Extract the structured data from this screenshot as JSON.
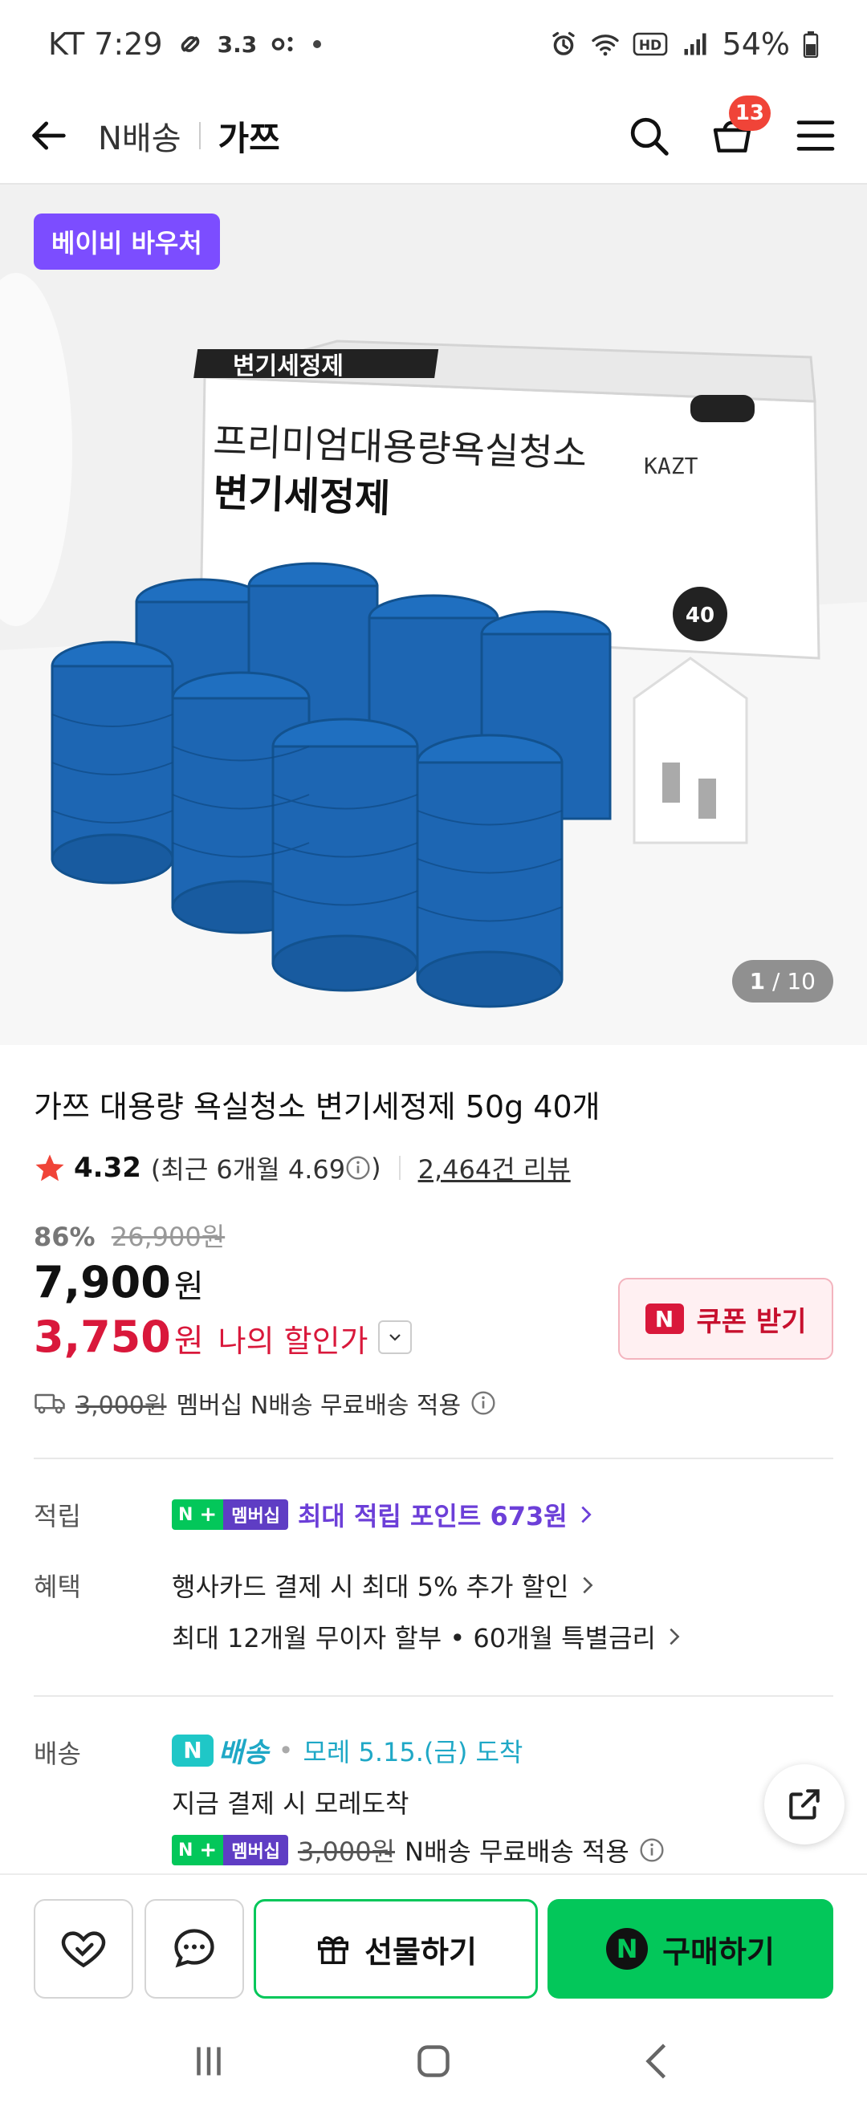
{
  "status_bar": {
    "carrier_time": "KT 7:29",
    "speed": "3.3",
    "battery": "54%"
  },
  "nav": {
    "crumb": "N배송",
    "store": "가쯔",
    "cart_count": "13"
  },
  "hero": {
    "voucher": "베이비 바우처",
    "counter_current": "1",
    "counter_total": " / 10",
    "image_alt": "가쯔 대용량 욕실청소 변기세정제 제품 이미지"
  },
  "product": {
    "title": "가쯔 대용량 욕실청소 변기세정제 50g 40개",
    "rating": "4.32",
    "recent_rating": "(최근 6개월 4.69",
    "recent_rating_close": ")",
    "reviews": "2,464건 리뷰",
    "discount_rate": "86%",
    "original_price": "26,900원",
    "price": "7,900",
    "price_unit": "원",
    "my_price": "3,750",
    "my_price_unit": "원",
    "my_price_label": "나의 할인가",
    "coupon_label": "쿠폰 받기",
    "coupon_badge": "N",
    "shipping_fee": "3,000원",
    "shipping_note": "멤버십 N배송 무료배송 적용"
  },
  "points": {
    "label": "적립",
    "badge_n": "N",
    "badge_plus": "+",
    "badge_member": "멤버십",
    "text": "최대 적립 포인트 673원"
  },
  "benefits": {
    "label": "혜택",
    "line1": "행사카드 결제 시 최대 5% 추가 할인",
    "line2": "최대 12개월 무이자 할부 • 60개월 특별금리"
  },
  "delivery": {
    "label": "배송",
    "tag_n": "N",
    "tag_text": "배송",
    "dot": "•",
    "date": "모레 5.15.(금) 도착",
    "line2": "지금 결제 시 모레도착",
    "fee": "3,000원",
    "fee_note": "N배송 무료배송 적용"
  },
  "bottom_bar": {
    "gift_label": "선물하기",
    "buy_label": "구매하기",
    "buy_badge": "N"
  },
  "colors": {
    "naver_green": "#03c75a",
    "sale_red": "#d9183b",
    "membership_purple": "#5f3dc4",
    "voucher_purple": "#7c4dff",
    "delivery_cyan": "#1fa8c6"
  },
  "icons": [
    "back-arrow-icon",
    "search-icon",
    "cart-icon",
    "menu-icon",
    "star-icon",
    "info-icon",
    "chevron-down-icon",
    "truck-icon",
    "chevron-right-icon",
    "share-icon",
    "heart-icon",
    "chat-icon",
    "gift-icon",
    "recents-icon",
    "home-icon",
    "back-icon"
  ]
}
